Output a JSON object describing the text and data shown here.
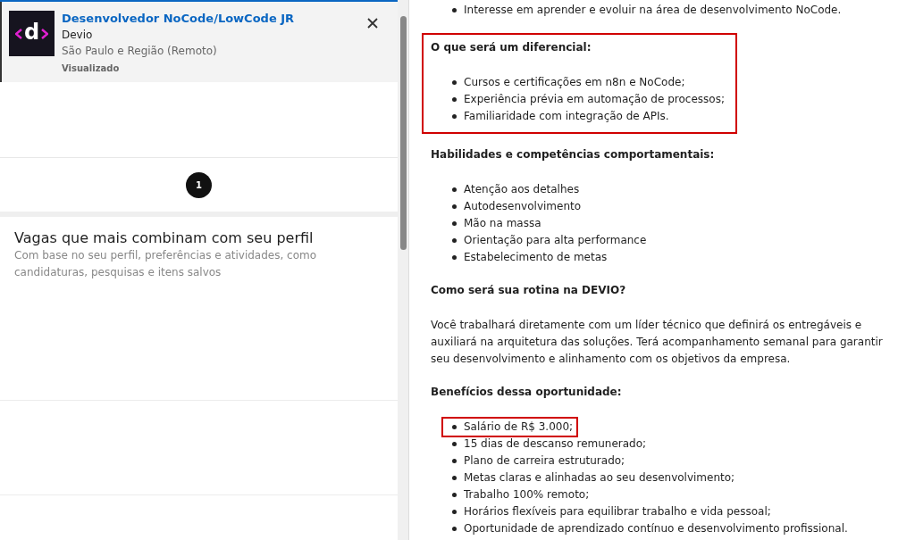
{
  "job_card": {
    "title": "Desenvolvedor NoCode/LowCode JR",
    "company": "Devio",
    "location": "São Paulo e Região (Remoto)",
    "status": "Visualizado",
    "logo_letter": "d",
    "selected": true
  },
  "pagination": [
    {
      "label": "1",
      "selected": true
    }
  ],
  "recommendations": {
    "title": "Vagas que mais combinam com seu perfil",
    "subtitle": "Com base no seu perfil, preferências e atividades, como candidaturas, pesquisas e itens salvos"
  },
  "description": [
    {
      "highlighted": false,
      "items": [
        {
          "text": "Interesse em aprender e evoluir na área de desenvolvimento NoCode.",
          "highlighted": false
        }
      ]
    },
    {
      "heading": "O que será um diferencial:",
      "highlighted": true,
      "items": [
        {
          "text": "Cursos e certificações em n8n e NoCode;",
          "highlighted": false
        },
        {
          "text": "Experiência prévia em automação de processos;",
          "highlighted": false
        },
        {
          "text": "Familiaridade com integração de APIs.",
          "highlighted": false
        }
      ]
    },
    {
      "heading": "Habilidades e competências comportamentais:",
      "highlighted": false,
      "items": [
        {
          "text": "Atenção aos detalhes",
          "highlighted": false
        },
        {
          "text": "Autodesenvolvimento",
          "highlighted": false
        },
        {
          "text": "Mão na massa",
          "highlighted": false
        },
        {
          "text": "Orientação para alta performance",
          "highlighted": false
        },
        {
          "text": "Estabelecimento de metas",
          "highlighted": false
        }
      ]
    },
    {
      "heading": "Como será sua rotina na DEVIO?",
      "highlighted": false,
      "paragraph": "Você trabalhará diretamente com um líder técnico que definirá os entregáveis e auxiliará na arquitetura das soluções. Terá acompanhamento semanal para garantir seu desenvolvimento e alinhamento com os objetivos da empresa."
    },
    {
      "heading": "Benefícios dessa oportunidade:",
      "highlighted": false,
      "items": [
        {
          "text": "Salário de R$ 3.000;",
          "highlighted": true
        },
        {
          "text": "15 dias de descanso remunerado;",
          "highlighted": false
        },
        {
          "text": "Plano de carreira estruturado;",
          "highlighted": false
        },
        {
          "text": "Metas claras e alinhadas ao seu desenvolvimento;",
          "highlighted": false
        },
        {
          "text": "Trabalho 100% remoto;",
          "highlighted": false
        },
        {
          "text": "Horários flexíveis para equilibrar trabalho e vida pessoal;",
          "highlighted": false
        },
        {
          "text": "Oportunidade de aprendizado contínuo e desenvolvimento profissional.",
          "highlighted": false
        }
      ]
    }
  ]
}
